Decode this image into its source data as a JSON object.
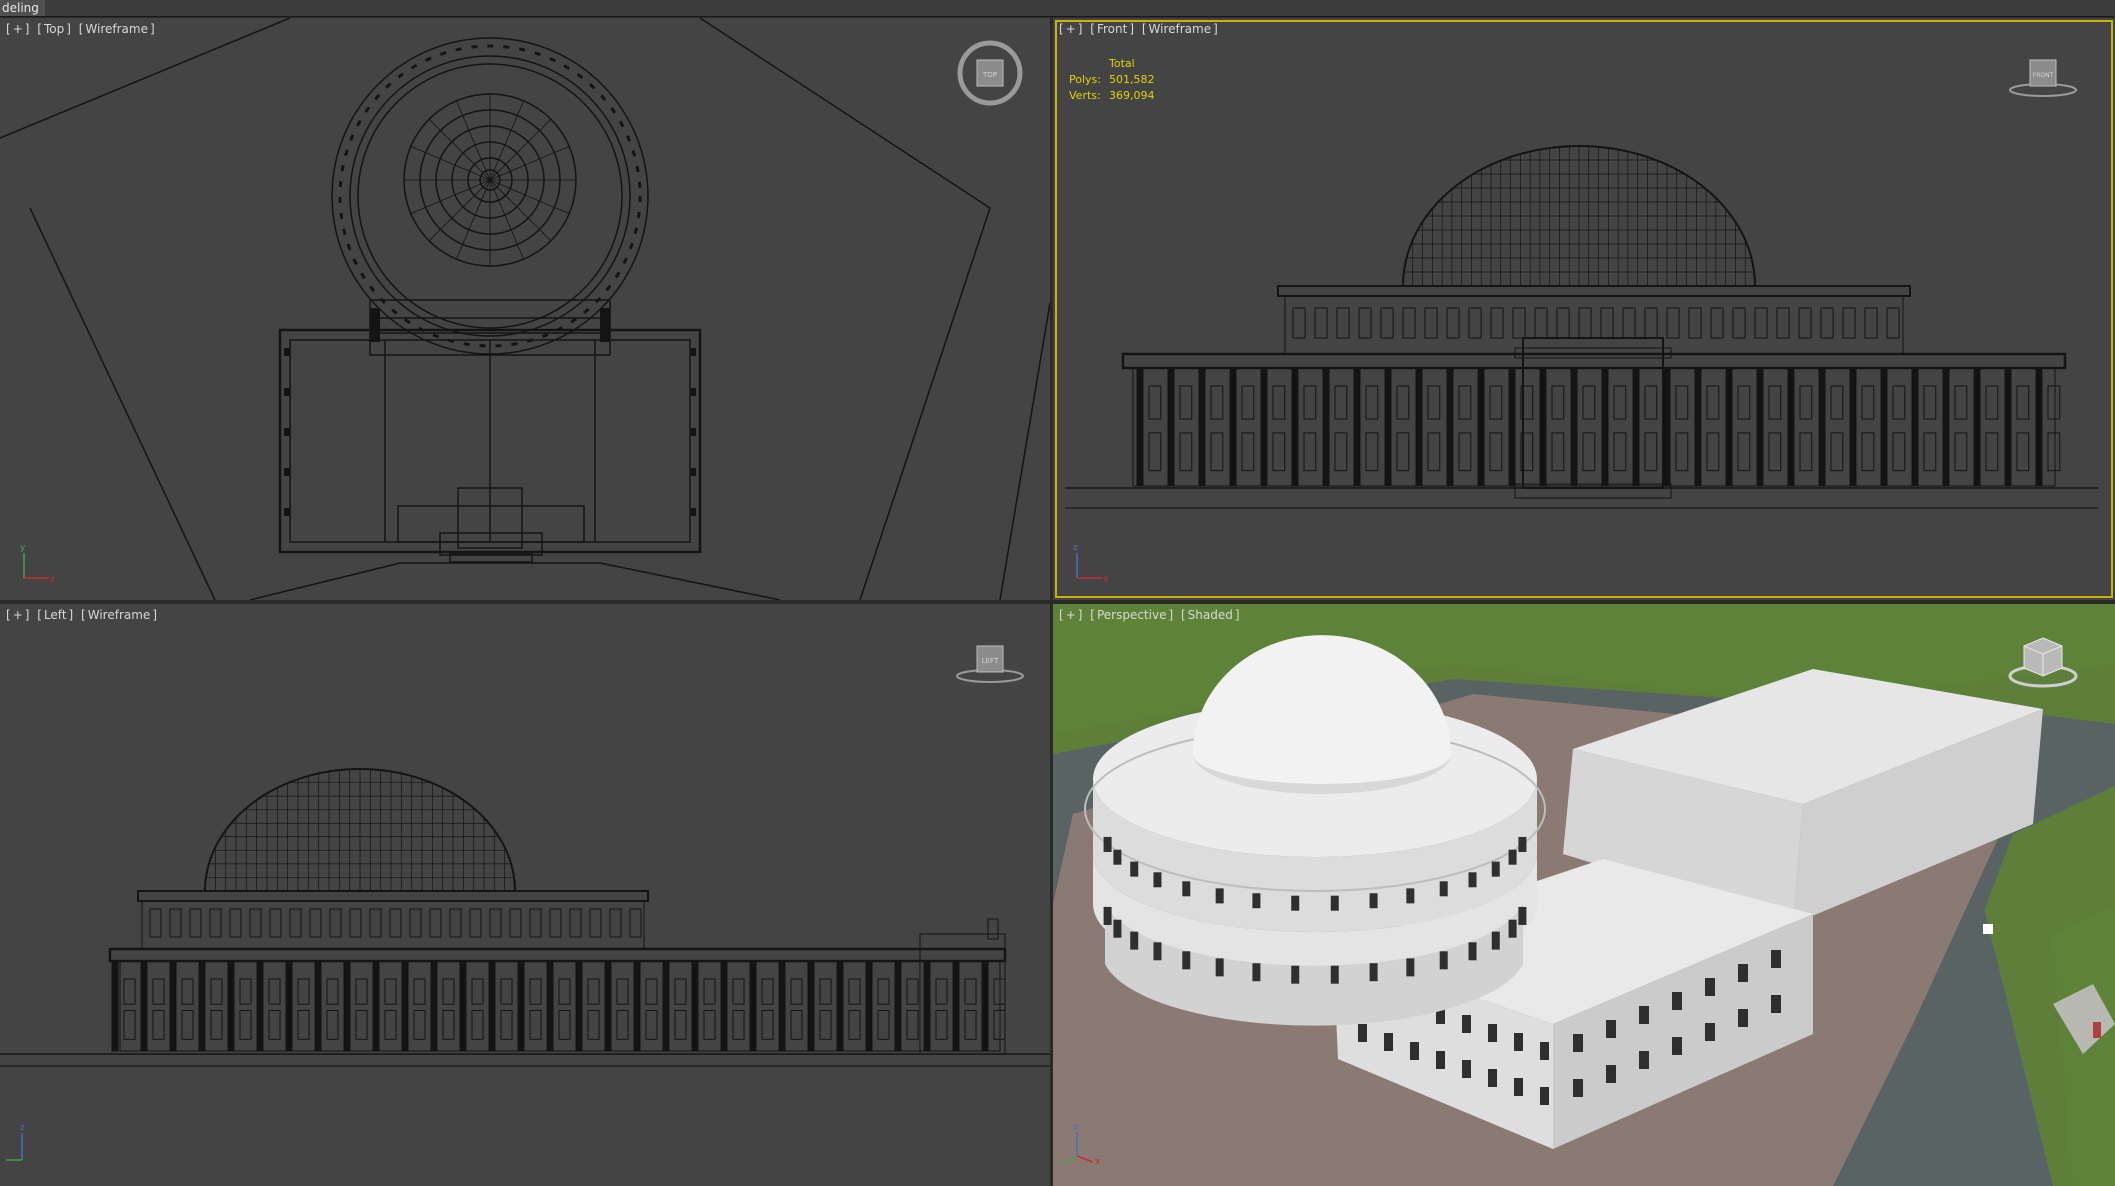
{
  "app": {
    "mode_label": "deling"
  },
  "viewports": {
    "top": {
      "plus": "+",
      "view": "Top",
      "shading": "Wireframe",
      "cube_label": "TOP"
    },
    "front": {
      "plus": "+",
      "view": "Front",
      "shading": "Wireframe",
      "cube_label": "FRONT"
    },
    "left": {
      "plus": "+",
      "view": "Left",
      "shading": "Wireframe",
      "cube_label": "LEFT"
    },
    "perspective": {
      "plus": "+",
      "view": "Perspective",
      "shading": "Shaded"
    }
  },
  "stats": {
    "header": "Total",
    "polys_label": "Polys:",
    "polys_value": "501,582",
    "verts_label": "Verts:",
    "verts_value": "369,094"
  },
  "axes": {
    "x": "x",
    "y": "y",
    "z": "z"
  },
  "colors": {
    "viewport_bg": "#444444",
    "wire": "#141414",
    "active_border": "#c8b400",
    "stats_text": "#e6d200",
    "grass": "#5d7f3a",
    "pavement": "#8a7a73",
    "road": "#5a6364",
    "building": "#e2e2e2"
  }
}
